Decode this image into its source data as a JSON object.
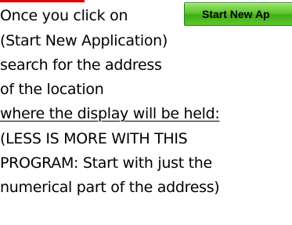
{
  "instructions": {
    "line1": "Once you click on",
    "line2": "(Start New Application)",
    "line3": "search for the address",
    "line4": "of the location",
    "line5": "where the display will be held:",
    "line6": "(LESS IS MORE WITH THIS",
    "line7": "PROGRAM: Start with just the",
    "line8": "numerical part of the address)"
  },
  "button": {
    "label": "Start New Ap"
  },
  "colors": {
    "accent_bar": "#e00000",
    "button_green": "#5cc72c"
  }
}
